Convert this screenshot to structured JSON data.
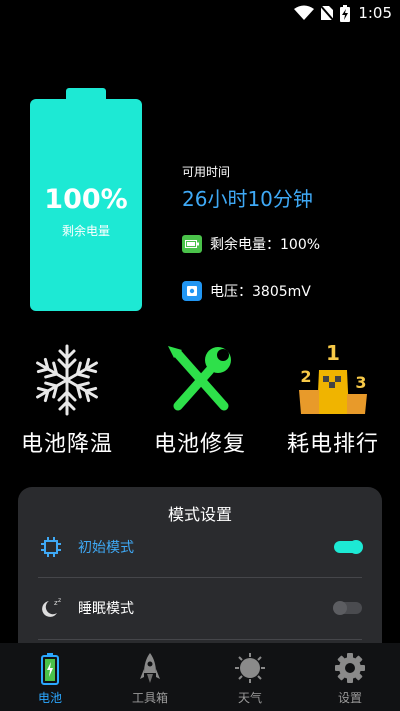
{
  "status_bar": {
    "time": "1:05"
  },
  "battery": {
    "percent": "100%",
    "level": 1.0,
    "label": "剩余电量",
    "available_label": "可用时间",
    "available_time": "26小时10分钟",
    "remaining_text": "剩余电量：100%",
    "voltage_text": "电压：3805mV",
    "fill_color": "#1de9d4"
  },
  "features": [
    {
      "label": "电池降温",
      "icon": "snowflake-icon"
    },
    {
      "label": "电池修复",
      "icon": "repair-tools-icon"
    },
    {
      "label": "耗电排行",
      "icon": "ranking-podium-icon"
    }
  ],
  "mode_settings": {
    "title": "模式设置",
    "modes": [
      {
        "label": "初始模式",
        "icon": "chip-icon",
        "enabled": true,
        "color": "#3fa9f5"
      },
      {
        "label": "睡眠模式",
        "icon": "sleep-moon-icon",
        "enabled": false,
        "color": "#ffffff"
      }
    ]
  },
  "bottom_nav": {
    "items": [
      {
        "label": "电池",
        "icon": "battery-icon",
        "active": true
      },
      {
        "label": "工具箱",
        "icon": "rocket-icon",
        "active": false
      },
      {
        "label": "天气",
        "icon": "weather-icon",
        "active": false
      },
      {
        "label": "设置",
        "icon": "gear-icon",
        "active": false
      }
    ],
    "active_color": "#2ba8ff"
  }
}
